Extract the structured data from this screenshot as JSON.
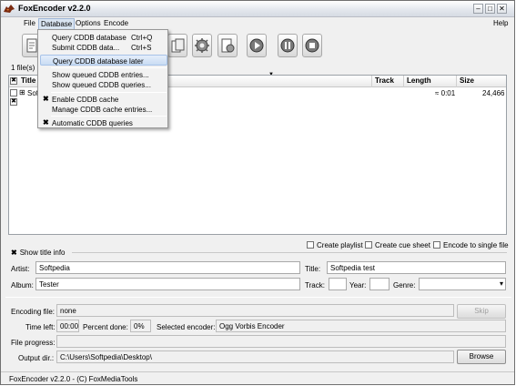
{
  "window": {
    "title": "FoxEncoder v2.2.0",
    "controls": {
      "minimize": "–",
      "maximize": "□",
      "close": "✕"
    }
  },
  "menu": {
    "file": "File",
    "database": "Database",
    "options": "Options",
    "encode": "Encode",
    "help": "Help"
  },
  "database_menu": {
    "items": [
      {
        "label": "Query CDDB database",
        "shortcut": "Ctrl+Q"
      },
      {
        "label": "Submit CDDB data...",
        "shortcut": "Ctrl+S"
      },
      {
        "label": "Query CDDB database later",
        "shortcut": ""
      },
      {
        "label": "Show queued CDDB entries...",
        "shortcut": ""
      },
      {
        "label": "Show queued CDDB queries...",
        "shortcut": ""
      },
      {
        "label": "Enable CDDB cache",
        "shortcut": "",
        "checked": true
      },
      {
        "label": "Manage CDDB cache entries...",
        "shortcut": ""
      },
      {
        "label": "Automatic CDDB queries",
        "shortcut": "",
        "checked": true
      }
    ],
    "check_mark": "✖"
  },
  "file_list": {
    "count_label": "1 file(s) ir",
    "columns": {
      "title": "Title",
      "track": "Track",
      "length": "Length",
      "size": "Size"
    },
    "rows": [
      {
        "title": "Soft",
        "length": "≈ 0:01",
        "size": "24,466"
      }
    ],
    "expander": "⊞"
  },
  "options": {
    "create_playlist": "Create playlist",
    "create_cue_sheet": "Create cue sheet",
    "encode_single": "Encode to single file"
  },
  "title_info": {
    "toggle_label": "Show title info",
    "toggle_mark": "✖",
    "artist_label": "Artist:",
    "artist_value": "Softpedia",
    "title_label": "Title:",
    "title_value": "Softpedia test",
    "album_label": "Album:",
    "album_value": "Tester",
    "track_label": "Track:",
    "track_value": "",
    "year_label": "Year:",
    "year_value": "",
    "genre_label": "Genre:",
    "genre_value": "",
    "dropdown_arrow": "▾"
  },
  "encoding": {
    "file_label": "Encoding file:",
    "file_value": "none",
    "skip_label": "Skip",
    "time_left_label": "Time left:",
    "time_left_value": "00:00",
    "percent_label": "Percent done:",
    "percent_value": "0%",
    "encoder_label": "Selected encoder:",
    "encoder_value": "Ogg Vorbis Encoder",
    "progress_label": "File progress:",
    "progress_value": 0,
    "output_label": "Output dir.:",
    "output_value": "C:\\Users\\Softpedia\\Desktop\\",
    "browse_label": "Browse"
  },
  "status": {
    "text": "FoxEncoder v2.2.0 - (C) FoxMediaTools"
  },
  "colors": {
    "menu_highlight": "#c9dcf3",
    "window_bg": "#f0f0f0"
  }
}
